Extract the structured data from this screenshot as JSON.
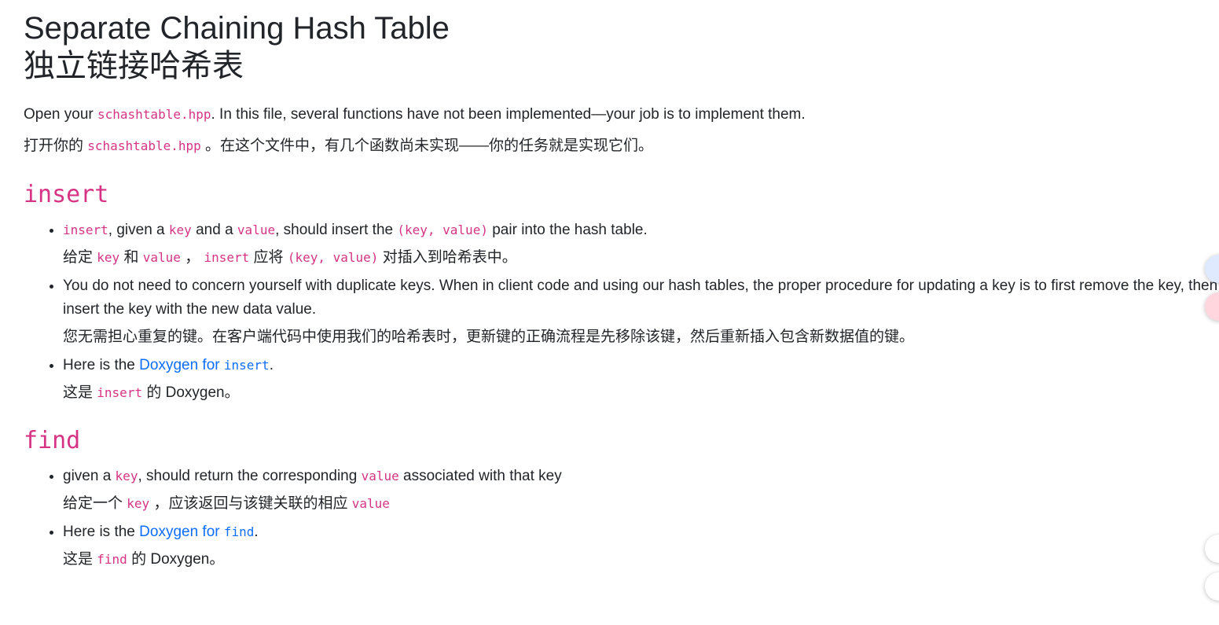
{
  "title_en": "Separate Chaining Hash Table",
  "title_zh": "独立链接哈希表",
  "intro": {
    "en_pre": "Open your ",
    "en_code": "schashtable.hpp",
    "en_post": ". In this file, several functions have not been implemented—your job is to implement them.",
    "zh_pre": "打开你的 ",
    "zh_code": "schashtable.hpp",
    "zh_post": " 。在这个文件中，有几个函数尚未实现——你的任务就是实现它们。"
  },
  "insert": {
    "heading": "insert",
    "b1": {
      "c1": "insert",
      "t1": ", given a ",
      "c2": "key",
      "t2": " and a ",
      "c3": "value",
      "t3": ", should insert the ",
      "c4": "(key, value)",
      "t4": " pair into the hash table.",
      "z1": "给定 ",
      "zc1": "key",
      "z2": " 和 ",
      "zc2": "value",
      "z3": " ， ",
      "zc3": "insert",
      "z4": " 应将 ",
      "zc4": "(key, value)",
      "z5": " 对插入到哈希表中。"
    },
    "b2": {
      "en": "You do not need to concern yourself with duplicate keys. When in client code and using our hash tables, the proper procedure for updating a key is to first remove the key, then re-insert the key with the new data value.",
      "zh": "您无需担心重复的键。在客户端代码中使用我们的哈希表时，更新键的正确流程是先移除该键，然后重新插入包含新数据值的键。"
    },
    "b3": {
      "pre": "Here is the ",
      "link": "Doxygen for ",
      "link_code": "insert",
      "post": ".",
      "zh_pre": "这是 ",
      "zh_code": "insert",
      "zh_post": " 的 Doxygen。"
    }
  },
  "find": {
    "heading": "find",
    "b1": {
      "t1": "given a ",
      "c1": "key",
      "t2": ", should return the corresponding ",
      "c2": "value",
      "t3": " associated with that key",
      "z1": "给定一个 ",
      "zc1": "key",
      "z2": " ，应该返回与该键关联的相应 ",
      "zc2": "value"
    },
    "b2": {
      "pre": "Here is the ",
      "link": "Doxygen for ",
      "link_code": "find",
      "post": ".",
      "zh_pre": "这是 ",
      "zh_code": "find",
      "zh_post": " 的 Doxygen。"
    }
  }
}
